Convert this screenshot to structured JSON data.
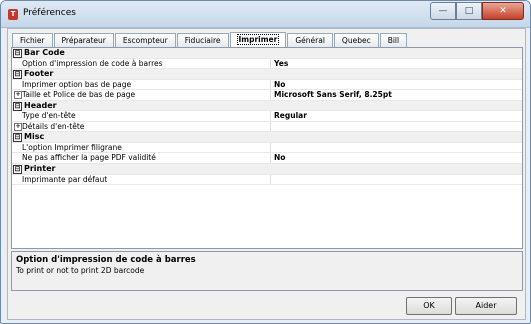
{
  "window": {
    "title": "Préférences",
    "minimize_glyph": "—",
    "maximize_glyph": "□",
    "close_glyph": "✕"
  },
  "tabs": [
    {
      "label": "Fichier",
      "active": false
    },
    {
      "label": "Préparateur",
      "active": false
    },
    {
      "label": "Escompteur",
      "active": false
    },
    {
      "label": "Fiduciaire",
      "active": false
    },
    {
      "label": "Imprimer",
      "active": true
    },
    {
      "label": "Général",
      "active": false
    },
    {
      "label": "Quebec",
      "active": false
    },
    {
      "label": "Bill",
      "active": false
    }
  ],
  "grid": {
    "rows": [
      {
        "type": "category",
        "toggle": "⊟",
        "name": "Bar Code",
        "value": ""
      },
      {
        "type": "property",
        "expander": "",
        "name": "Option d'impression de code à barres",
        "value": "Yes"
      },
      {
        "type": "category",
        "toggle": "⊟",
        "name": "Footer",
        "value": ""
      },
      {
        "type": "property",
        "expander": "",
        "name": "Imprimer option bas de page",
        "value": "No"
      },
      {
        "type": "property",
        "expander": "+",
        "name": "Taille et Police de bas de page",
        "value": "Microsoft Sans Serif, 8.25pt"
      },
      {
        "type": "category",
        "toggle": "⊟",
        "name": "Header",
        "value": ""
      },
      {
        "type": "property",
        "expander": "",
        "name": "Type d'en-tête",
        "value": "Regular"
      },
      {
        "type": "property",
        "expander": "+",
        "name": "Détails d'en-tête",
        "value": ""
      },
      {
        "type": "category",
        "toggle": "⊟",
        "name": "Misc",
        "value": ""
      },
      {
        "type": "property",
        "expander": "",
        "name": "L'option Imprimer filigrane",
        "value": ""
      },
      {
        "type": "property",
        "expander": "",
        "name": "Ne pas afficher la page PDF validité",
        "value": "No"
      },
      {
        "type": "category",
        "toggle": "⊟",
        "name": "Printer",
        "value": ""
      },
      {
        "type": "property",
        "expander": "",
        "name": "Imprimante par défaut",
        "value": ""
      }
    ]
  },
  "description": {
    "title": "Option d'impression de code à barres",
    "text": "To print or not to print 2D barcode"
  },
  "buttons": {
    "ok": "OK",
    "help": "Aider"
  }
}
